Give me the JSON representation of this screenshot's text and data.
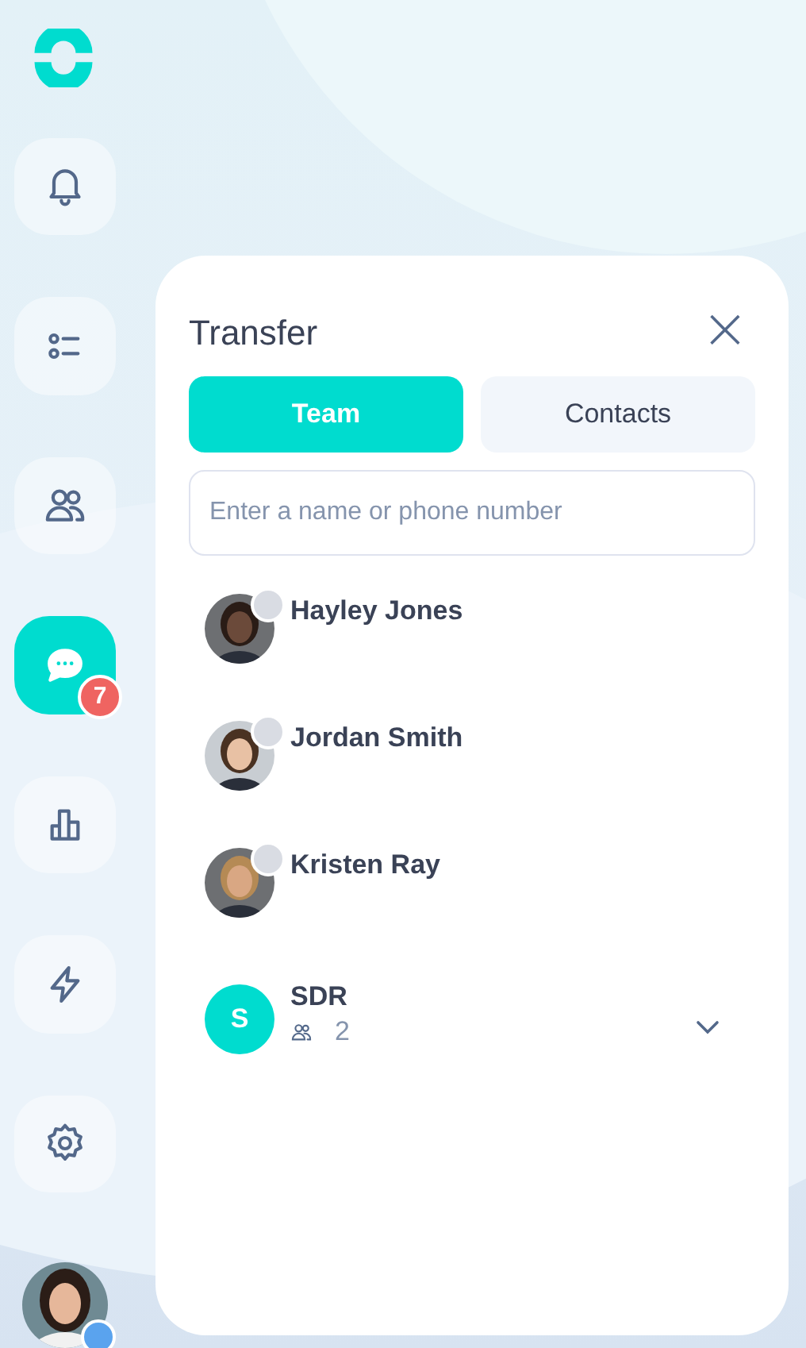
{
  "sidebar": {
    "items": [
      {
        "kind": "bell",
        "selected": false
      },
      {
        "kind": "list",
        "selected": false
      },
      {
        "kind": "people",
        "selected": false
      },
      {
        "kind": "chat",
        "selected": true,
        "badge": "7"
      },
      {
        "kind": "chart",
        "selected": false
      },
      {
        "kind": "bolt",
        "selected": false
      },
      {
        "kind": "gear",
        "selected": false
      }
    ],
    "profile": {
      "color": "#5aa3ee"
    }
  },
  "panel": {
    "title": "Transfer",
    "close": "×",
    "tabs": [
      {
        "label": "Team",
        "selected": true
      },
      {
        "label": "Contacts",
        "selected": false
      }
    ],
    "search": {
      "placeholder": "Enter a name or phone number"
    },
    "entries": [
      {
        "kind": "person",
        "name": "Hayley Jones",
        "color": "#d9dce3"
      },
      {
        "kind": "person",
        "name": "Jordan Smith",
        "color": "#d9dce3"
      },
      {
        "kind": "person",
        "name": "Kristen Ray",
        "color": "#d9dce3"
      },
      {
        "kind": "group",
        "name": "SDR",
        "initial": "S",
        "members": "2",
        "expanded": false
      }
    ]
  }
}
